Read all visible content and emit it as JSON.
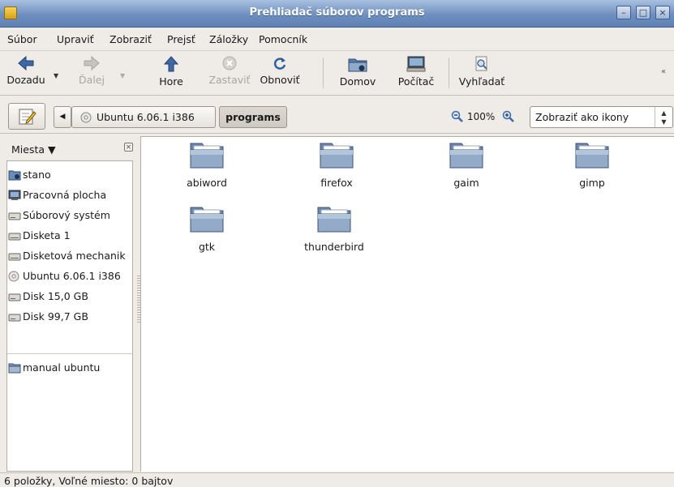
{
  "window": {
    "title": "Prehliadač súborov programs"
  },
  "menu": [
    "Súbor",
    "Upraviť",
    "Zobraziť",
    "Prejsť",
    "Záložky",
    "Pomocník"
  ],
  "toolbar": {
    "back": "Dozadu",
    "forward": "Ďalej",
    "up": "Hore",
    "stop": "Zastaviť",
    "reload": "Obnoviť",
    "home": "Domov",
    "computer": "Počítač",
    "search": "Vyhľadať"
  },
  "location": {
    "crumbs": [
      "Ubuntu 6.06.1 i386",
      "programs"
    ],
    "zoom": "100%",
    "view_mode": "Zobraziť ako ikony"
  },
  "sidebar": {
    "title": "Miesta",
    "items": [
      {
        "label": "stano",
        "icon": "home-folder-icon"
      },
      {
        "label": "Pracovná plocha",
        "icon": "desktop-icon"
      },
      {
        "label": "Súborový systém",
        "icon": "harddisk-icon"
      },
      {
        "label": "Disketa 1",
        "icon": "floppy-icon"
      },
      {
        "label": "Disketová mechanik",
        "icon": "floppy-drive-icon"
      },
      {
        "label": "Ubuntu 6.06.1 i386",
        "icon": "cdrom-icon"
      },
      {
        "label": "Disk 15,0 GB",
        "icon": "harddisk-icon"
      },
      {
        "label": "Disk 99,7 GB",
        "icon": "harddisk-icon"
      },
      {
        "label": "manual ubuntu",
        "icon": "folder-icon"
      }
    ]
  },
  "files": [
    "abiword",
    "firefox",
    "gaim",
    "gimp",
    "gtk",
    "thunderbird"
  ],
  "status": {
    "text": "6 položky, Voľné miesto: 0 bajtov"
  },
  "colors": {
    "titlebar": "#6e8fbf",
    "folder": "#7d95b5",
    "window_bg": "#efebe7"
  }
}
